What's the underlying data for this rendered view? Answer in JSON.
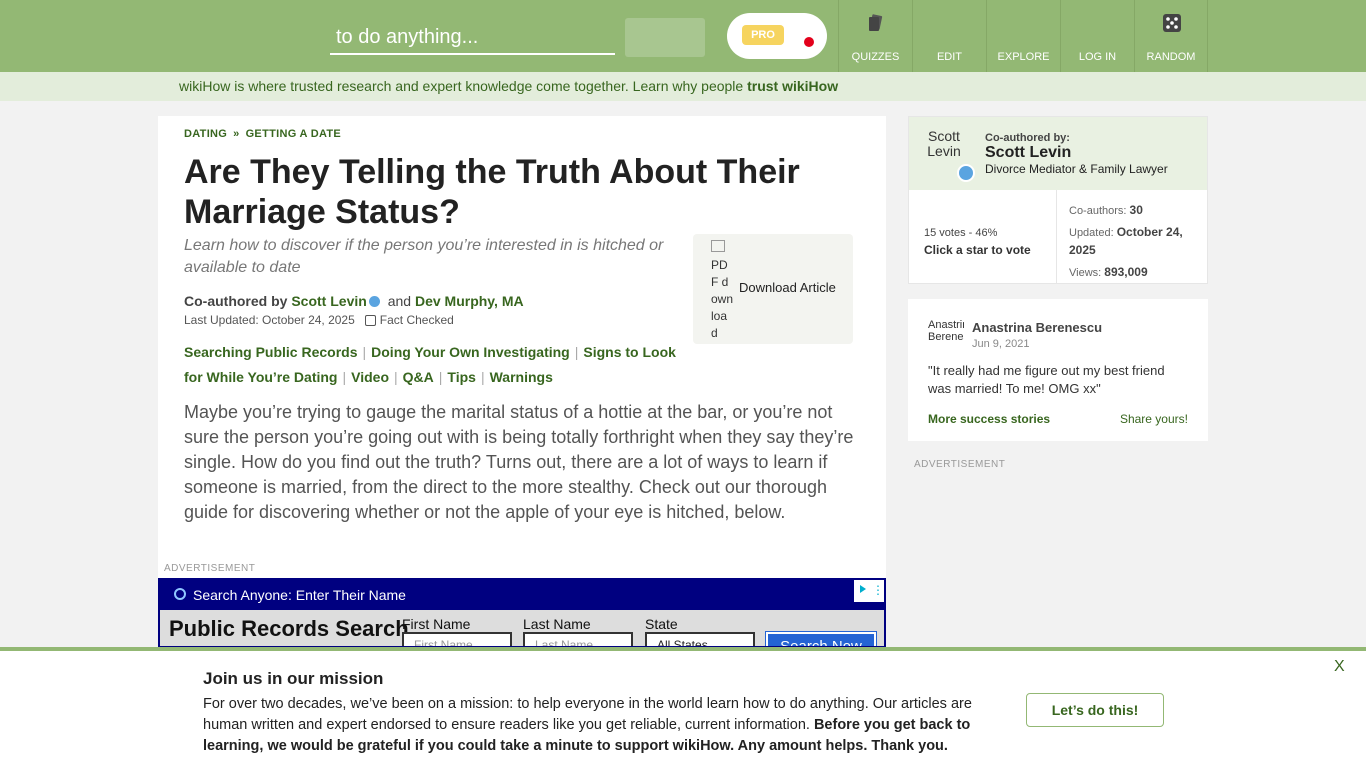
{
  "header": {
    "search_placeholder": "to do anything...",
    "pro_label": "PRO",
    "nav": [
      {
        "label": "QUIZZES",
        "icon": "quizzes-icon"
      },
      {
        "label": "EDIT",
        "icon": "edit-icon"
      },
      {
        "label": "EXPLORE",
        "icon": "explore-icon"
      },
      {
        "label": "LOG IN",
        "icon": "login-icon"
      },
      {
        "label": "RANDOM",
        "icon": "random-dice-icon"
      }
    ]
  },
  "trust_bar": {
    "text": "wikiHow is where trusted research and expert knowledge come together. Learn why people",
    "link": "trust wikiHow"
  },
  "article": {
    "breadcrumbs": [
      "DATING",
      "GETTING A DATE"
    ],
    "breadcrumb_sep": "»",
    "title": "Are They Telling the Truth About Their Marriage Status?",
    "subtitle": "Learn how to discover if the person you’re interested in is hitched or available to date",
    "coauthored_label": "Co-authored by",
    "author1": "Scott Levin",
    "and": "and",
    "author2": "Dev Murphy, MA",
    "updated": "Last Updated: October 24, 2025",
    "fact_checked": "Fact Checked",
    "download_img_alt": "PDF download",
    "download_label": "Download Article",
    "toc": [
      "Searching Public Records",
      "Doing Your Own Investigating",
      "Signs to Look for While You’re Dating",
      "Video",
      "Q&A",
      "Tips",
      "Warnings"
    ],
    "intro": "Maybe you’re trying to gauge the marital status of a hottie at the bar, or you’re not sure the person you’re going out with is being totally forthright when they say they’re single. How do you find out the truth? Turns out, there are a lot of ways to learn if someone is married, from the direct to the more stealthy. Check out our thorough guide for discovering whether or not the apple of your eye is hitched, below.",
    "advertisement": "ADVERTISEMENT"
  },
  "ad": {
    "bar_text": "Search Anyone: Enter Their Name",
    "heading": "Public Records Search",
    "first_name_label": "First Name",
    "last_name_label": "Last Name",
    "state_label": "State",
    "first_name_placeholder": "First Name",
    "last_name_placeholder": "Last Name",
    "state_value": "All States",
    "button": "Search Now"
  },
  "sidebar": {
    "avatar_alt": "Scott Levin",
    "coauthored_label": "Co-authored by:",
    "name": "Scott Levin",
    "role": "Divorce Mediator & Family Lawyer",
    "votes": "15 votes - 46%",
    "vote_cta": "Click a star to vote",
    "coauthors_label": "Co-authors:",
    "coauthors_value": "30",
    "updated_label": "Updated:",
    "updated_value": "October 24, 2025",
    "views_label": "Views:",
    "views_value": "893,009",
    "advertisement": "ADVERTISEMENT"
  },
  "story": {
    "avatar_alt": "Anastrina Berenescu",
    "name": "Anastrina Berenescu",
    "date": "Jun 9, 2021",
    "quote": "\"It really had me figure out my best friend was married! To me! OMG xx\"",
    "more": "More success stories",
    "share": "Share yours!"
  },
  "banner": {
    "title": "Join us in our mission",
    "text_plain": "For over two decades, we’ve been on a mission: to help everyone in the world learn how to do anything. Our articles are human written and expert endorsed to ensure readers like you get reliable, current information.",
    "text_bold": "Before you get back to learning, we would be grateful if you could take a minute to support wikiHow. Any amount helps. Thank you.",
    "button": "Let’s do this!",
    "close": "X"
  },
  "colors": {
    "brand_green": "#93b874",
    "link_green": "#38661f",
    "ad_navy": "#000080",
    "verified_blue": "#5aa4e0"
  }
}
